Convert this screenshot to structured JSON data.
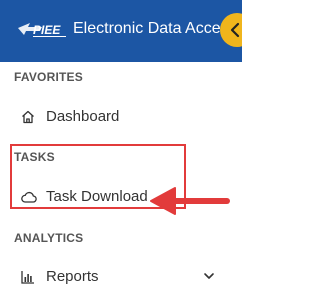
{
  "header": {
    "logo_text": "PIEE",
    "title": "Electronic Data Access",
    "collapse_icon": "chevron-left-icon"
  },
  "sidebar": {
    "favorites": {
      "label": "FAVORITES",
      "items": [
        {
          "label": "Dashboard",
          "icon": "home-icon"
        }
      ]
    },
    "tasks": {
      "label": "TASKS",
      "items": [
        {
          "label": "Task Download",
          "icon": "cloud-icon"
        }
      ]
    },
    "analytics": {
      "label": "ANALYTICS",
      "items": [
        {
          "label": "Reports",
          "icon": "bar-chart-icon",
          "expand_icon": "chevron-down-icon"
        }
      ]
    }
  },
  "annotation": {
    "highlight_color": "#e23b3b"
  },
  "colors": {
    "header_bg": "#1c56a4",
    "accent": "#f0b51c",
    "section_text": "#555555",
    "item_text": "#333333"
  }
}
